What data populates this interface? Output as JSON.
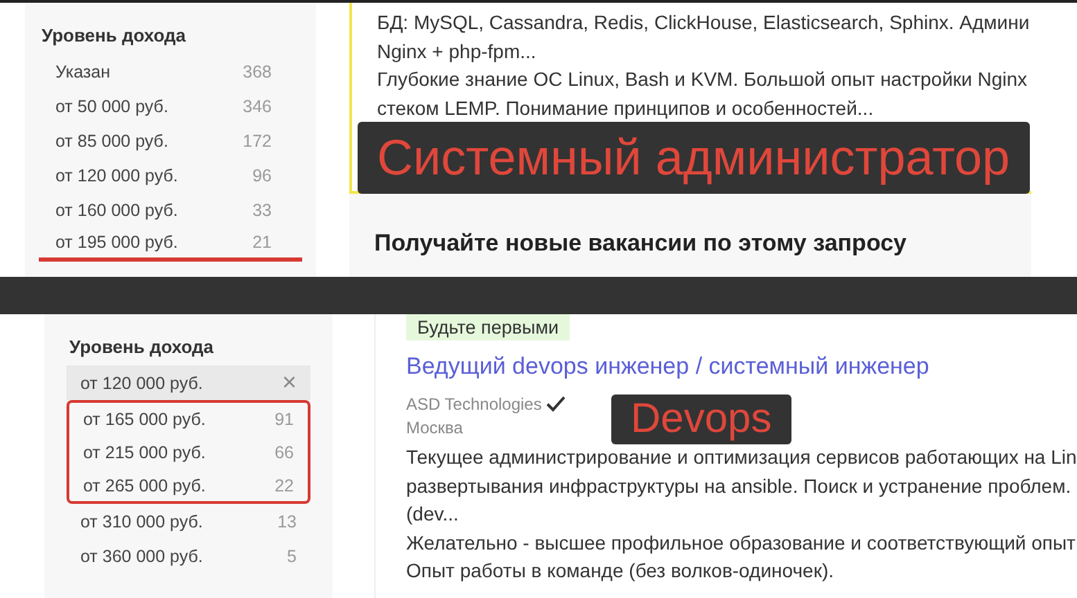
{
  "top": {
    "sidebar": {
      "title": "Уровень дохода",
      "items": [
        {
          "label": "Указан",
          "count": "368",
          "underlined": false
        },
        {
          "label": "от 50 000 руб.",
          "count": "346",
          "underlined": false
        },
        {
          "label": "от 85 000 руб.",
          "count": "172",
          "underlined": false
        },
        {
          "label": "от 120 000 руб.",
          "count": "96",
          "underlined": false
        },
        {
          "label": "от 160 000 руб.",
          "count": "33",
          "underlined": false
        },
        {
          "label": "от 195 000 руб.",
          "count": "21",
          "underlined": true
        }
      ]
    },
    "snippet": [
      "БД: MySQL, Cassandra, Redis, ClickHouse, Elasticsearch, Sphinx. Админи",
      "Nginx + php-fpm...",
      "Глубокие знание ОС Linux, Bash и KVM. Большой опыт настройки Nginx",
      "стеком LEMP. Понимание принципов и особенностей..."
    ],
    "banner": "Системный администратор",
    "subscribe_title": "Получайте новые вакансии по этому запросу"
  },
  "bottom": {
    "sidebar": {
      "title": "Уровень дохода",
      "selected_filter": {
        "label": "от 120 000 руб.",
        "remove": "×"
      },
      "items": [
        {
          "label": "от 165 000 руб.",
          "count": "91",
          "highlighted": true
        },
        {
          "label": "от 215 000 руб.",
          "count": "66",
          "highlighted": true
        },
        {
          "label": "от 265 000 руб.",
          "count": "22",
          "highlighted": true
        },
        {
          "label": "от 310 000 руб.",
          "count": "13",
          "highlighted": false
        },
        {
          "label": "от 360 000 руб.",
          "count": "5",
          "highlighted": false
        }
      ]
    },
    "vacancy": {
      "badge": "Будьте первыми",
      "title": "Ведущий devops инженер / системный инженер",
      "company": "ASD Technologies",
      "verified": true,
      "city": "Москва",
      "description": [
        "Текущее администрирование и оптимизация сервисов работающих на Lin",
        "развертывания инфраструктуры на ansible. Поиск и устранение проблем.",
        "(dev...",
        "Желательно - высшее профильное образование и соответствующий опыт",
        "Опыт работы в команде (без волков-одиночек)."
      ]
    },
    "banner": "Devops"
  }
}
